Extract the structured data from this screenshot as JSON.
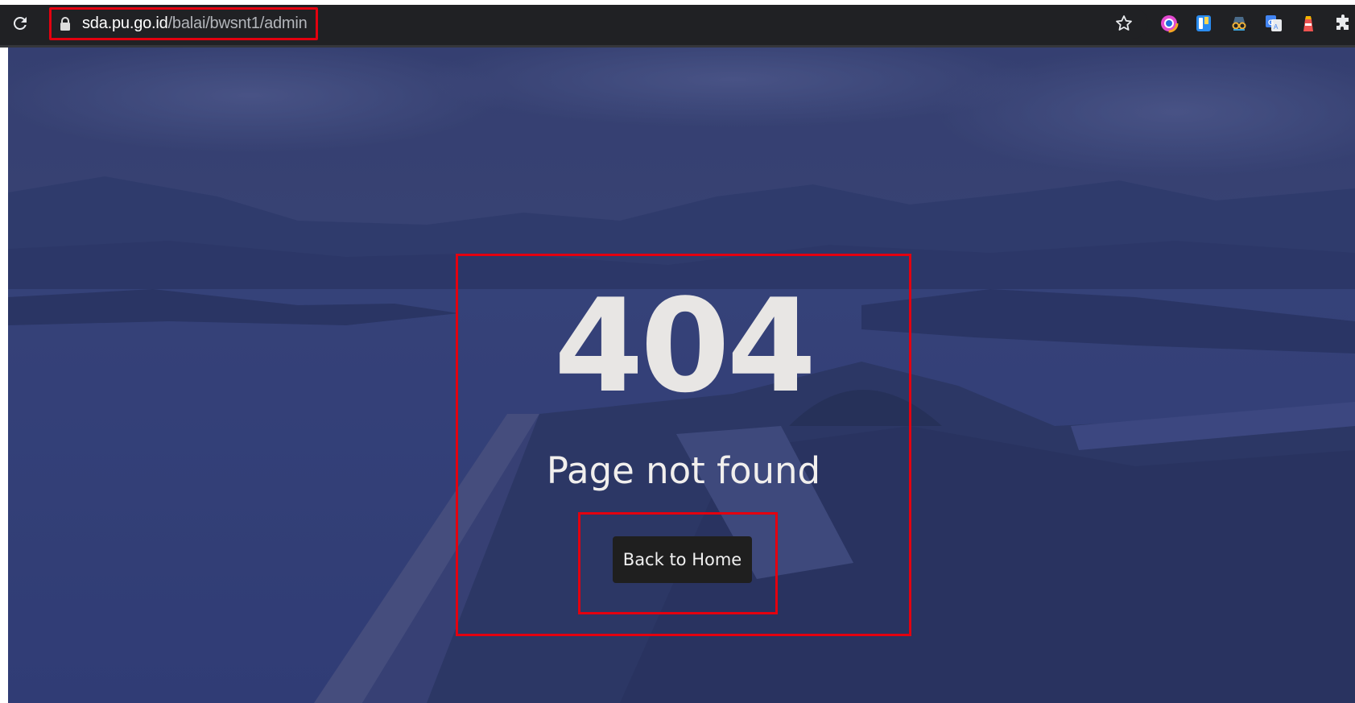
{
  "browser": {
    "url_host": "sda.pu.go.id",
    "url_path": "/balai/bwsnt1/admin",
    "extensions": [
      {
        "name": "color-ring-extension-icon"
      },
      {
        "name": "bookmark-extension-icon"
      },
      {
        "name": "spy-glasses-extension-icon"
      },
      {
        "name": "google-translate-extension-icon"
      },
      {
        "name": "lighthouse-extension-icon"
      },
      {
        "name": "puzzle-extensions-icon"
      }
    ]
  },
  "error_page": {
    "code": "404",
    "message": "Page not found",
    "button_label": "Back to Home"
  },
  "colors": {
    "annotation_red": "#e3000f",
    "overlay_blue": "#3a4575",
    "button_dark": "#1f1f1f"
  }
}
